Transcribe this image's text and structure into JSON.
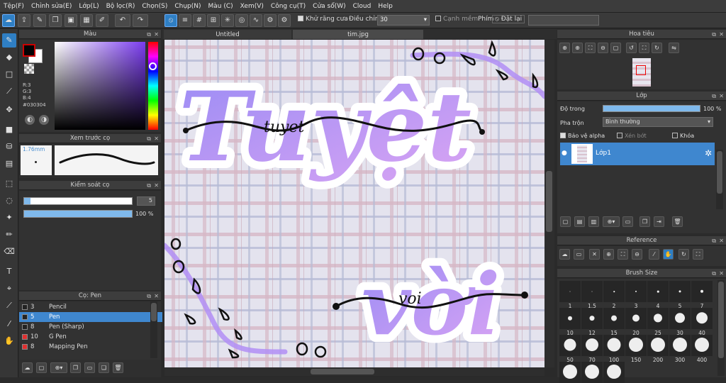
{
  "menu": [
    "Tệp(F)",
    "Chỉnh sửa(E)",
    "Lớp(L)",
    "Bộ lọc(R)",
    "Chọn(S)",
    "Chụp(N)",
    "Màu (C)",
    "Xem(V)",
    "Công cụ(T)",
    "Cửa sổ(W)",
    "Cloud",
    "Help"
  ],
  "toolbar": {
    "antialias_label": "Khử răng cưa",
    "correction_label": "Điều chỉnh",
    "correction_value": "30",
    "edge_label": "Cạnh mềm",
    "phim_label": "Phím",
    "reset_label": "Đặt lại"
  },
  "color_panel": {
    "title": "Màu",
    "r": "R:3",
    "g": "G:3",
    "b": "B:4",
    "hex": "#030304",
    "fg": "#030304",
    "bg": "#ffffff"
  },
  "brush_preview": {
    "title": "Xem trước cọ",
    "size": "1.76mm"
  },
  "brush_control": {
    "title": "Kiểm soát cọ",
    "size_value": "5",
    "opacity_value": "100 %",
    "size_fraction": 0.06,
    "opacity_fraction": 1.0
  },
  "brush_list": {
    "title": "Cọ: Pen",
    "items": [
      {
        "num": "3",
        "name": "Pencil",
        "color": "#222222"
      },
      {
        "num": "5",
        "name": "Pen",
        "color": "#222222",
        "selected": true
      },
      {
        "num": "8",
        "name": "Pen (Sharp)",
        "color": "#222222"
      },
      {
        "num": "10",
        "name": "G Pen",
        "color": "#e03030"
      },
      {
        "num": "8",
        "name": "Mapping Pen",
        "color": "#e03030"
      }
    ]
  },
  "tabs": [
    "Untitled",
    "tim.jpg"
  ],
  "artwork": {
    "word1": "Tuyệt",
    "word2": "vời",
    "cursive1": "tuyet",
    "cursive2": "voi"
  },
  "navigator": {
    "title": "Hoa tiêu"
  },
  "layers": {
    "title": "Lớp",
    "opacity_label": "Độ trong",
    "opacity_value": "100 %",
    "opacity_fraction": 1.0,
    "blend_label": "Pha trộn",
    "blend_value": "Bình thường",
    "protect_alpha": "Bảo vệ alpha",
    "clip": "Xén bớt",
    "lock": "Khóa",
    "layer_name": "Lớp1"
  },
  "reference": {
    "title": "Reference"
  },
  "brush_size": {
    "title": "Brush Size",
    "sizes": [
      "1",
      "1.5",
      "2",
      "3",
      "4",
      "5",
      "7",
      "10",
      "12",
      "15",
      "20",
      "25",
      "30",
      "40",
      "50",
      "70",
      "100",
      "150",
      "200",
      "300",
      "400",
      "",
      "",
      ""
    ]
  }
}
